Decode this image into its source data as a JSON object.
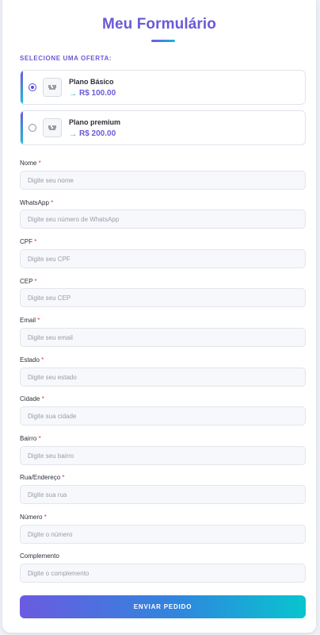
{
  "form": {
    "title": "Meu Formulário",
    "offer_section_label": "SELECIONE UMA OFERTA:",
    "offers": [
      {
        "name": "Plano Básico",
        "arrow": "→",
        "price": "R$ 100.00",
        "selected": true
      },
      {
        "name": "Plano premium",
        "arrow": "→",
        "price": "R$ 200.00",
        "selected": false
      }
    ],
    "required_mark": "*",
    "fields": [
      {
        "label": "Nome",
        "required": true,
        "placeholder": "Digite seu nome",
        "value": ""
      },
      {
        "label": "WhatsApp",
        "required": true,
        "placeholder": "Digite seu número de WhatsApp",
        "value": ""
      },
      {
        "label": "CPF",
        "required": true,
        "placeholder": "Digite seu CPF",
        "value": ""
      },
      {
        "label": "CEP",
        "required": true,
        "placeholder": "Digite seu CEP",
        "value": ""
      },
      {
        "label": "Email",
        "required": true,
        "placeholder": "Digite seu email",
        "value": ""
      },
      {
        "label": "Estado",
        "required": true,
        "placeholder": "Digite seu estado",
        "value": ""
      },
      {
        "label": "Cidade",
        "required": true,
        "placeholder": "Digite sua cidade",
        "value": ""
      },
      {
        "label": "Bairro",
        "required": true,
        "placeholder": "Digite seu bairro",
        "value": ""
      },
      {
        "label": "Rua/Endereço",
        "required": true,
        "placeholder": "Digite sua rua",
        "value": ""
      },
      {
        "label": "Número",
        "required": true,
        "placeholder": "Digite o número",
        "value": ""
      },
      {
        "label": "Complemento",
        "required": false,
        "placeholder": "Digite o complemento",
        "value": ""
      }
    ],
    "submit_label": "ENVIAR PEDIDO"
  },
  "colors": {
    "accent": "#6a5ad6",
    "accent_secondary": "#13b8d6",
    "required": "#e03a3a"
  },
  "icons": {
    "offer_thumbnail": "product-image-icon",
    "radio": "radio-icon",
    "price_arrow": "arrow-right-icon"
  }
}
